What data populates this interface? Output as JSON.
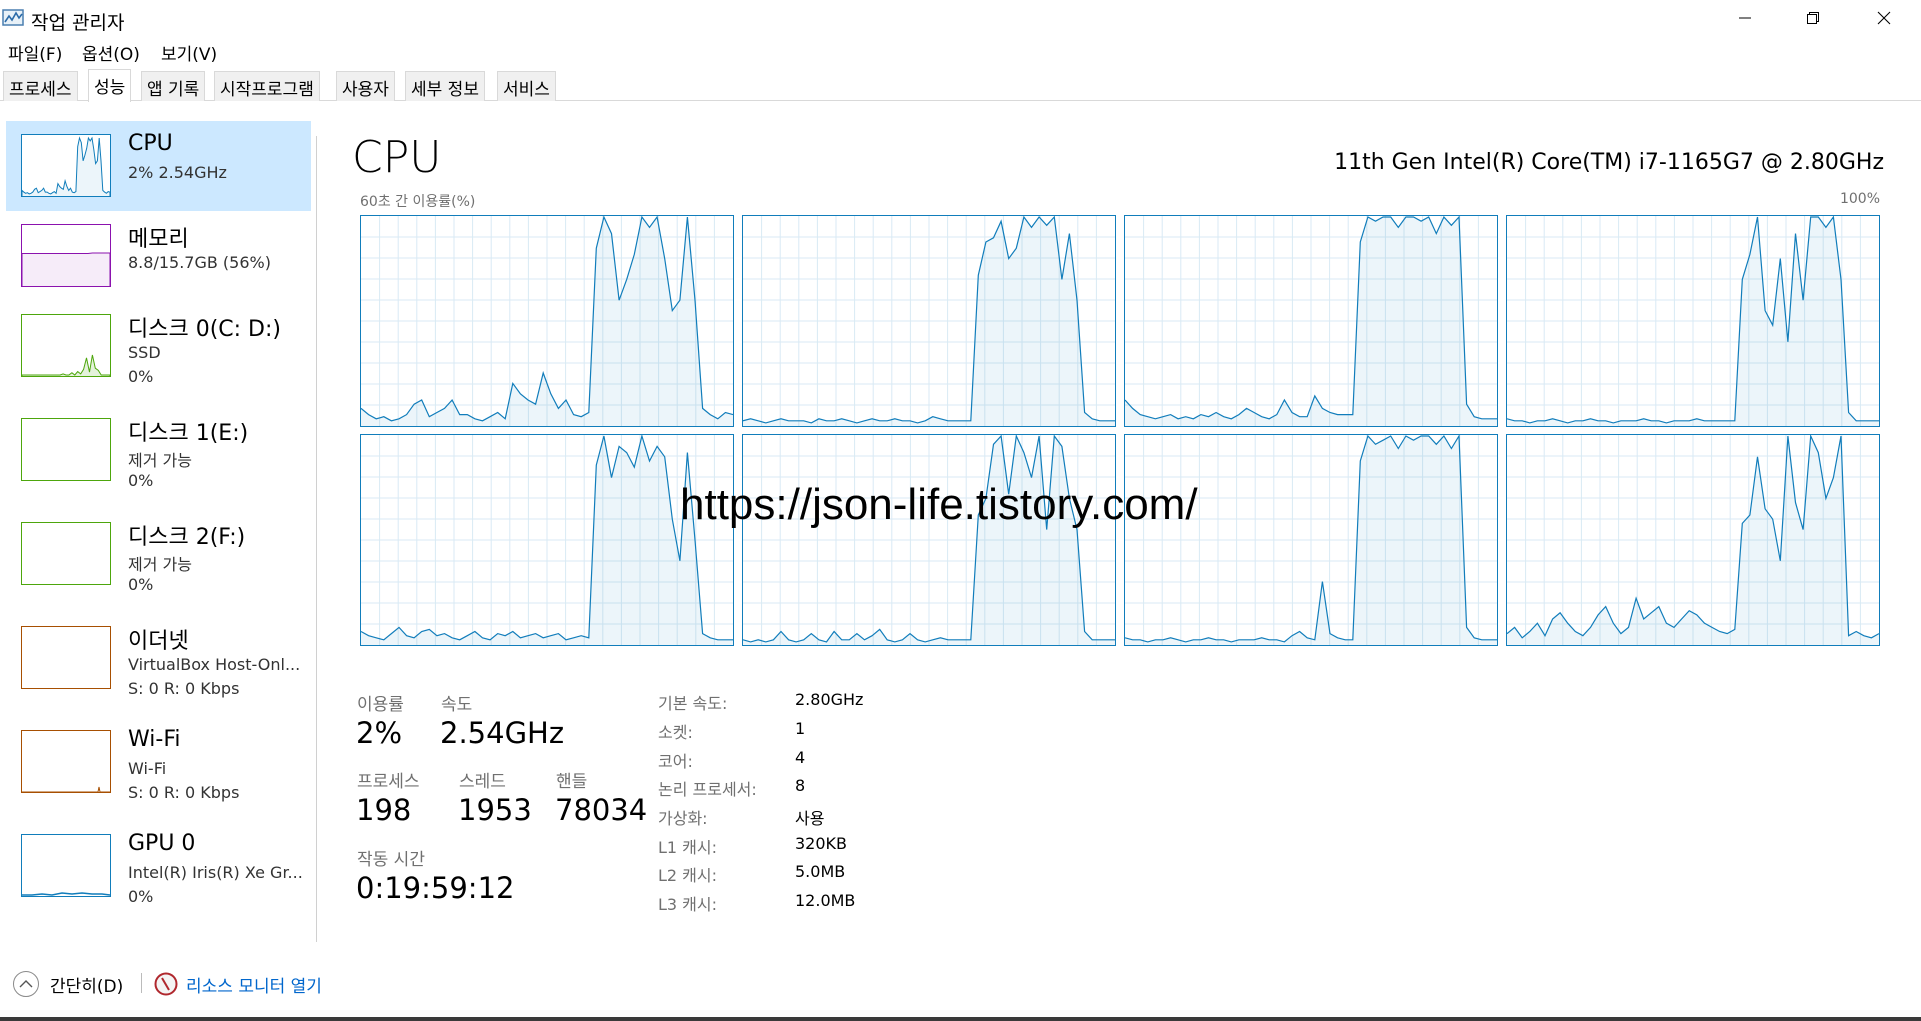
{
  "window": {
    "title": "작업 관리자"
  },
  "menu": [
    "파일(F)",
    "옵션(O)",
    "보기(V)"
  ],
  "tabs": [
    "프로세스",
    "성능",
    "앱 기록",
    "시작프로그램",
    "사용자",
    "세부 정보",
    "서비스"
  ],
  "active_tab": "성능",
  "sidebar": {
    "items": [
      {
        "title": "CPU",
        "sub": "2% 2.54GHz",
        "sub2": "",
        "color": "#117dbb",
        "selected": true,
        "thumb": "cpu"
      },
      {
        "title": "메모리",
        "sub": "8.8/15.7GB (56%)",
        "sub2": "",
        "color": "#8b12ae",
        "selected": false,
        "thumb": "memory"
      },
      {
        "title": "디스크 0(C: D:)",
        "sub": "SSD",
        "sub2": "0%",
        "color": "#4da60c",
        "selected": false,
        "thumb": "disk0"
      },
      {
        "title": "디스크 1(E:)",
        "sub": "제거 가능",
        "sub2": "0%",
        "color": "#4da60c",
        "selected": false,
        "thumb": "empty"
      },
      {
        "title": "디스크 2(F:)",
        "sub": "제거 가능",
        "sub2": "0%",
        "color": "#4da60c",
        "selected": false,
        "thumb": "empty"
      },
      {
        "title": "이더넷",
        "sub": "VirtualBox Host-Onl...",
        "sub2": "S: 0  R: 0 Kbps",
        "color": "#a74f01",
        "selected": false,
        "thumb": "empty"
      },
      {
        "title": "Wi-Fi",
        "sub": "Wi-Fi",
        "sub2": "S: 0  R: 0 Kbps",
        "color": "#a74f01",
        "selected": false,
        "thumb": "wifi"
      },
      {
        "title": "GPU 0",
        "sub": "Intel(R) Iris(R) Xe Gr...",
        "sub2": "0%",
        "color": "#117dbb",
        "selected": false,
        "thumb": "gpu"
      }
    ]
  },
  "main": {
    "title": "CPU",
    "cpu_model": "11th Gen Intel(R) Core(TM) i7-1165G7 @ 2.80GHz",
    "graph_label": "60초 간 이용률(%)",
    "graph_max": "100%",
    "graph_color": "#117dbb",
    "logical_processor_graphs": [
      {
        "util": [
          8,
          5,
          3,
          4,
          2,
          3,
          5,
          10,
          12,
          4,
          6,
          8,
          12,
          5,
          5,
          3,
          2,
          4,
          6,
          3,
          20,
          15,
          12,
          10,
          25,
          15,
          8,
          12,
          5,
          4,
          6,
          85,
          100,
          92,
          60,
          70,
          82,
          100,
          95,
          100,
          80,
          55,
          60,
          100,
          60,
          8,
          5,
          3,
          6,
          5
        ]
      },
      {
        "util": [
          2,
          3,
          2,
          1,
          2,
          3,
          2,
          2,
          2,
          1,
          3,
          2,
          2,
          3,
          2,
          1,
          2,
          3,
          2,
          2,
          3,
          2,
          2,
          1,
          2,
          4,
          3,
          2,
          2,
          2,
          2,
          72,
          88,
          90,
          98,
          80,
          85,
          100,
          95,
          100,
          96,
          100,
          70,
          92,
          60,
          6,
          3,
          2,
          2,
          2
        ]
      },
      {
        "util": [
          12,
          8,
          5,
          4,
          3,
          4,
          5,
          3,
          4,
          3,
          5,
          4,
          6,
          4,
          3,
          5,
          8,
          6,
          4,
          3,
          5,
          12,
          6,
          4,
          4,
          14,
          8,
          6,
          5,
          5,
          5,
          88,
          100,
          98,
          100,
          100,
          95,
          100,
          100,
          98,
          100,
          92,
          100,
          96,
          100,
          10,
          4,
          3,
          3,
          3
        ]
      },
      {
        "util": [
          3,
          2,
          2,
          1,
          2,
          2,
          3,
          2,
          1,
          2,
          2,
          3,
          2,
          2,
          1,
          2,
          2,
          2,
          3,
          2,
          2,
          1,
          2,
          2,
          2,
          3,
          2,
          2,
          2,
          2,
          2,
          70,
          82,
          100,
          55,
          48,
          80,
          40,
          92,
          60,
          100,
          100,
          95,
          100,
          70,
          6,
          2,
          2,
          2,
          2
        ]
      },
      {
        "util": [
          6,
          4,
          3,
          2,
          5,
          8,
          4,
          3,
          6,
          7,
          4,
          5,
          3,
          2,
          4,
          6,
          3,
          2,
          5,
          4,
          6,
          3,
          4,
          5,
          3,
          4,
          5,
          2,
          3,
          4,
          3,
          86,
          100,
          80,
          95,
          92,
          85,
          100,
          88,
          95,
          90,
          60,
          40,
          92,
          50,
          5,
          3,
          2,
          2,
          2
        ]
      },
      {
        "util": [
          2,
          1,
          2,
          1,
          2,
          6,
          2,
          1,
          2,
          5,
          2,
          1,
          6,
          2,
          2,
          5,
          2,
          4,
          7,
          2,
          1,
          2,
          5,
          2,
          1,
          2,
          3,
          2,
          2,
          2,
          2,
          62,
          70,
          96,
          100,
          72,
          100,
          92,
          80,
          100,
          55,
          100,
          95,
          70,
          55,
          6,
          2,
          2,
          2,
          2
        ]
      },
      {
        "util": [
          3,
          2,
          2,
          1,
          2,
          2,
          3,
          2,
          1,
          2,
          2,
          3,
          2,
          2,
          1,
          2,
          2,
          2,
          3,
          2,
          2,
          1,
          4,
          6,
          3,
          2,
          30,
          5,
          3,
          2,
          2,
          88,
          100,
          96,
          98,
          100,
          94,
          100,
          98,
          100,
          100,
          96,
          100,
          94,
          100,
          8,
          3,
          2,
          2,
          2
        ]
      },
      {
        "util": [
          5,
          8,
          3,
          6,
          10,
          4,
          12,
          15,
          10,
          6,
          4,
          8,
          14,
          18,
          10,
          5,
          8,
          22,
          12,
          15,
          18,
          10,
          8,
          12,
          16,
          14,
          10,
          8,
          6,
          5,
          7,
          58,
          62,
          90,
          65,
          60,
          40,
          100,
          68,
          55,
          100,
          92,
          70,
          80,
          100,
          4,
          6,
          4,
          3,
          5
        ]
      }
    ]
  },
  "stats": {
    "utilization": {
      "label": "이용률",
      "value": "2%"
    },
    "speed": {
      "label": "속도",
      "value": "2.54GHz"
    },
    "processes": {
      "label": "프로세스",
      "value": "198"
    },
    "threads": {
      "label": "스레드",
      "value": "1953"
    },
    "handles": {
      "label": "핸들",
      "value": "78034"
    },
    "uptime": {
      "label": "작동 시간",
      "value": "0:19:59:12"
    }
  },
  "specs": [
    {
      "key": "기본 속도:",
      "value": "2.80GHz"
    },
    {
      "key": "소켓:",
      "value": "1"
    },
    {
      "key": "코어:",
      "value": "4"
    },
    {
      "key": "논리 프로세서:",
      "value": "8"
    },
    {
      "key": "가상화:",
      "value": "사용"
    },
    {
      "key": "L1 캐시:",
      "value": "320KB"
    },
    {
      "key": "L2 캐시:",
      "value": "5.0MB"
    },
    {
      "key": "L3 캐시:",
      "value": "12.0MB"
    }
  ],
  "footer": {
    "fewer_details": "간단히(D)",
    "resource_monitor": "리소스 모니터 열기"
  },
  "watermark": "https://json-life.tistory.com/"
}
